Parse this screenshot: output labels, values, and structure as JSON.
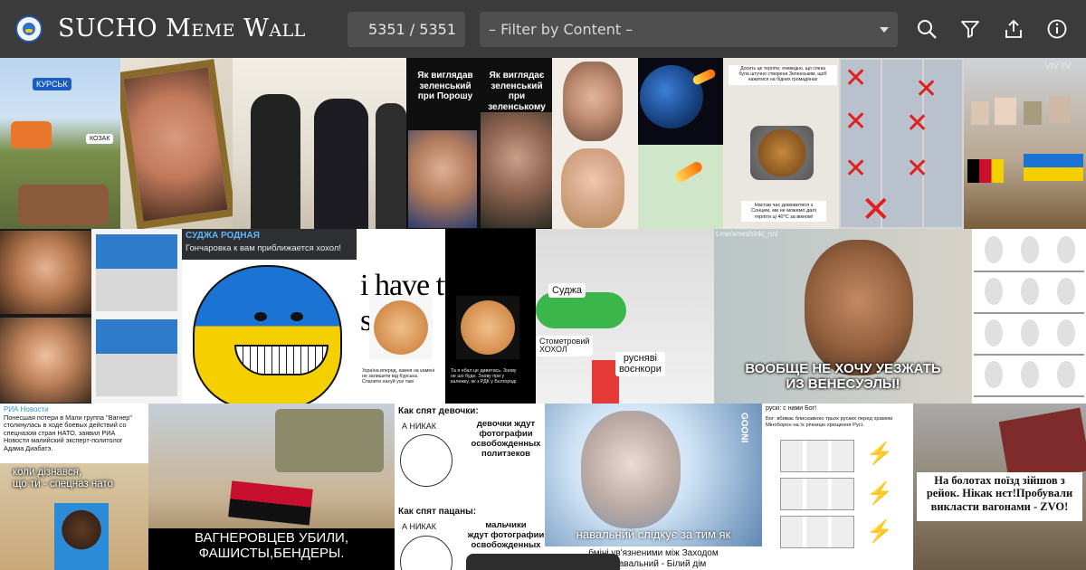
{
  "header": {
    "title": "SUCHO Meme Wall",
    "counter": "5351 / 5351",
    "filter_placeholder": "– Filter by Content –"
  },
  "memes": {
    "kursk_sign": "КУРСЬК",
    "kozak_sign": "КОЗАК",
    "zel_left": "Як виглядав\nзеленський\nпри Порошу",
    "zel_right": "Як виглядає\nзеленський\nпри зеленському",
    "tiktok_top": "Досить це терпіти, очевидно, що спека\nбула штучно створена Зеленським, щоб\nнажитися на бідних громадянах",
    "tiktok_bottom": "Настав час домовитися з\nСонцем, ми не можемо далі\nтерпіти ці 40°С за вікном!",
    "watermark_rt": "VIV TV",
    "sudzha_header": "СУДЖА РОДНАЯ",
    "sudzha_sub": "Гончаровка к вам приближается хохол!",
    "two_sides": "i have two sides",
    "two_sides_left": "Україна вперед, камня на камені\nне залишити від Курська.\nСпалити нахуй усе там",
    "two_sides_right": "Та я ебал це дивитись. Знову\nне шо буде. Знову при у\nкалежку, як з РДК у Бєлгороді",
    "sudzha_label": "Суджа",
    "hohol_label": "Стометровий\nХОХОЛ",
    "voenkor_label": "руснявi\nвоєнкори",
    "maduro_caption": "ВООБЩЕ НЕ ХОЧУ УЕЗЖАТЬ\nИЗ ВЕНЕСУЭЛЫ!",
    "smeshinki": "t.me/smeshinki_nnl",
    "ria_source": "РИА Новости",
    "ria_text": "Понесшая потери в Мали группа \"Вагнер\"\nстолкнулась в ходе боевых действий со\nспецназом стран НАТО, заявил РИА\nНовости малийский эксперт-политолог\nАдама Диабатэ.",
    "koli_caption": "коли дізнався,\nщо ти - спецназ нато",
    "wagner_caption": "ВАГНЕРОВЦЕВ УБИЛИ,\nФАШИСТЫ,БЕНДЕРЫ.",
    "sleep_girls_title": "Как спят девочки:",
    "sleep_girls_text": "девочки ждут\nфотографии\nосвобожденных\nполитзеков",
    "sleep_boys_title": "Как спят пацаны:",
    "sleep_boys_text": "мальчики\nждут фотографии\nосвобожденных",
    "a_nikak": "А НИКАК",
    "navalny_caption": "навальний слідкує за тим як",
    "navalny_sub": "бміні ув'язненими між Заходом\nти Навальний - Білий дім",
    "gooni": "GOONI",
    "rusky_title": "рускі: с нами Бог!",
    "rusky_text": "Бог: вбиває блискавкою трьох руских перед храмом\nМіноборон на їх річницю хрещення Русі.",
    "train_caption": "На болотах поїзд зійшов з\nрейок. Нікак нєт!Пробували\nвикласти вагонами - ZVO!"
  },
  "colors": {
    "header_bg": "#3b3b3b",
    "input_bg": "#4f4f4f",
    "ukraine_blue": "#1b73d3",
    "ukraine_yellow": "#f5d000"
  },
  "icons": [
    "logo-icon",
    "search-icon",
    "filter-icon",
    "share-icon",
    "info-icon"
  ]
}
